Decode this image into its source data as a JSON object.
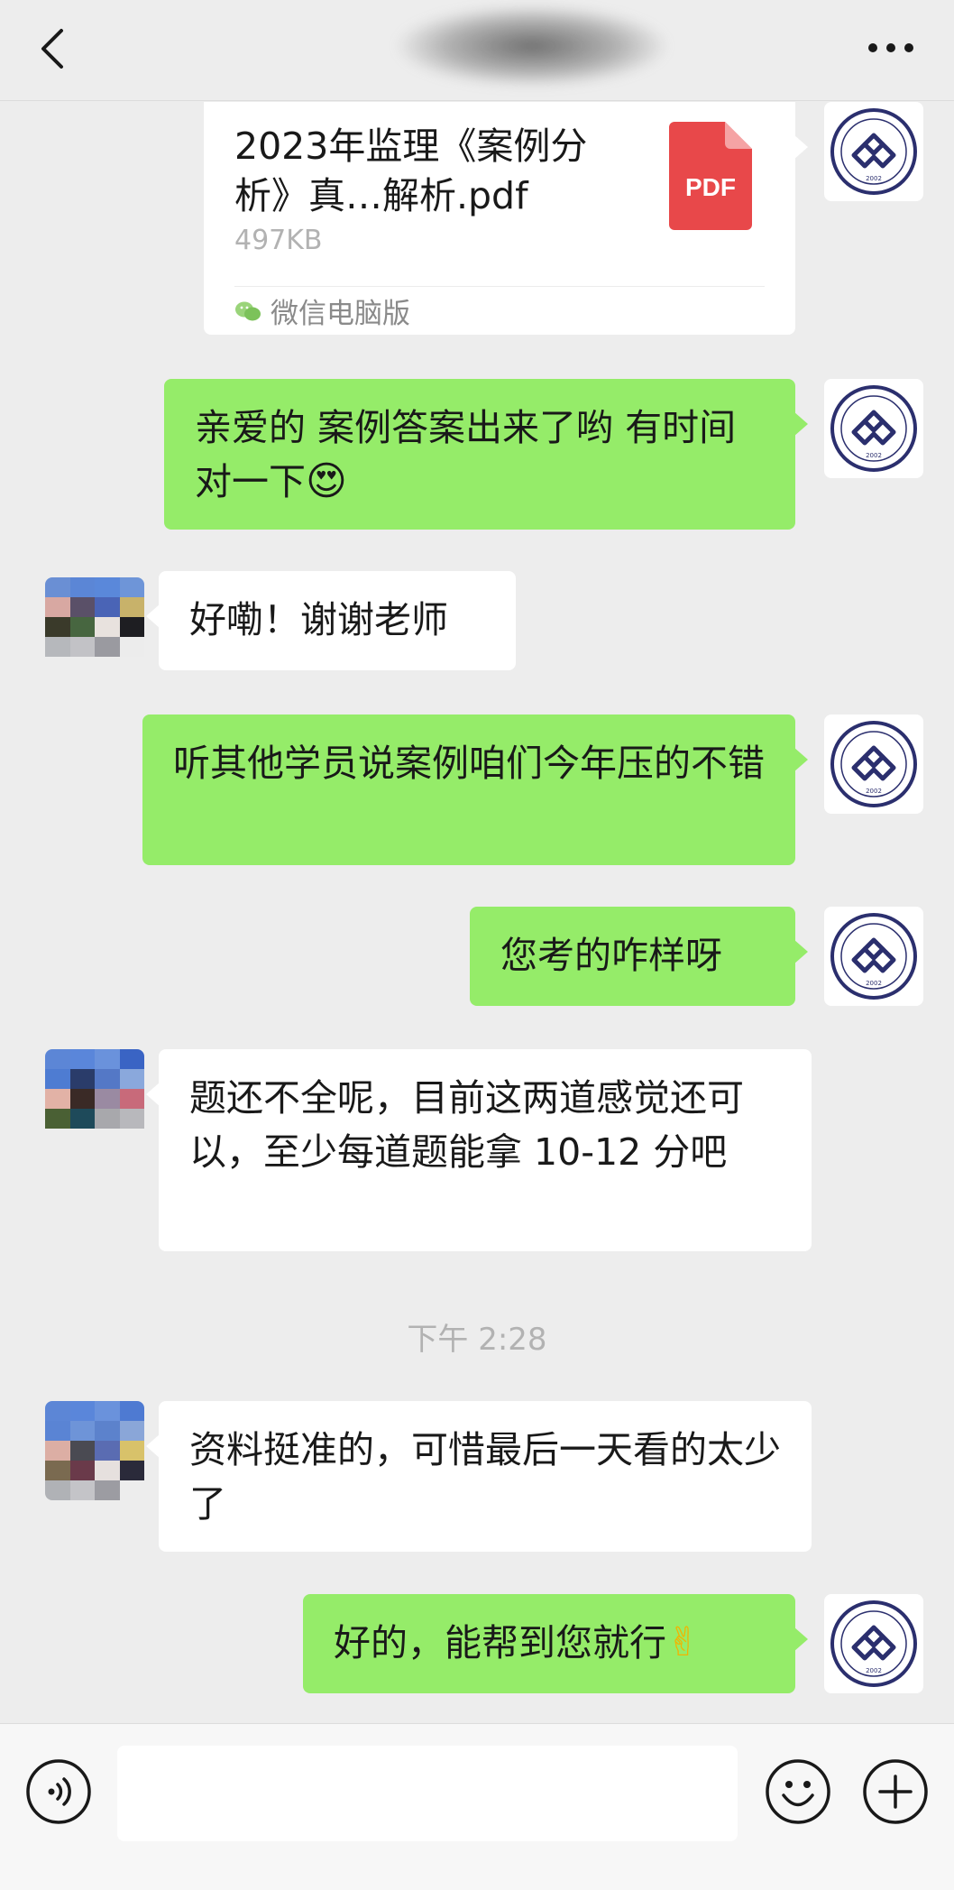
{
  "header": {
    "title_blurred": ""
  },
  "messages": {
    "file": {
      "name": "2023年监理《案例分析》真…解析.pdf",
      "size": "497KB",
      "source": "微信电脑版",
      "type_label": "PDF"
    },
    "m1": {
      "text": "亲爱的 案例答案出来了哟 有时间对一下",
      "emoji": "😍"
    },
    "m2": {
      "text": "好嘞！谢谢老师"
    },
    "m3": {
      "text": "听其他学员说案例咱们今年压的不错"
    },
    "m4": {
      "text": "您考的咋样呀"
    },
    "m5": {
      "text": "题还不全呢，目前这两道感觉还可以，至少每道题能拿 10-12 分吧"
    },
    "time": "下午 2:28",
    "m6": {
      "text": "资料挺准的，可惜最后一天看的太少了"
    },
    "m7": {
      "text": "好的，能帮到您就行",
      "emoji": "✌"
    }
  },
  "input": {
    "value": ""
  },
  "avatar": {
    "badge_year": "2002"
  },
  "colors": {
    "outgoing_bubble": "#95ec69",
    "incoming_bubble": "#ffffff",
    "background": "#ededed",
    "pdf_red": "#e8484a",
    "logo_navy": "#2b2f6e"
  }
}
